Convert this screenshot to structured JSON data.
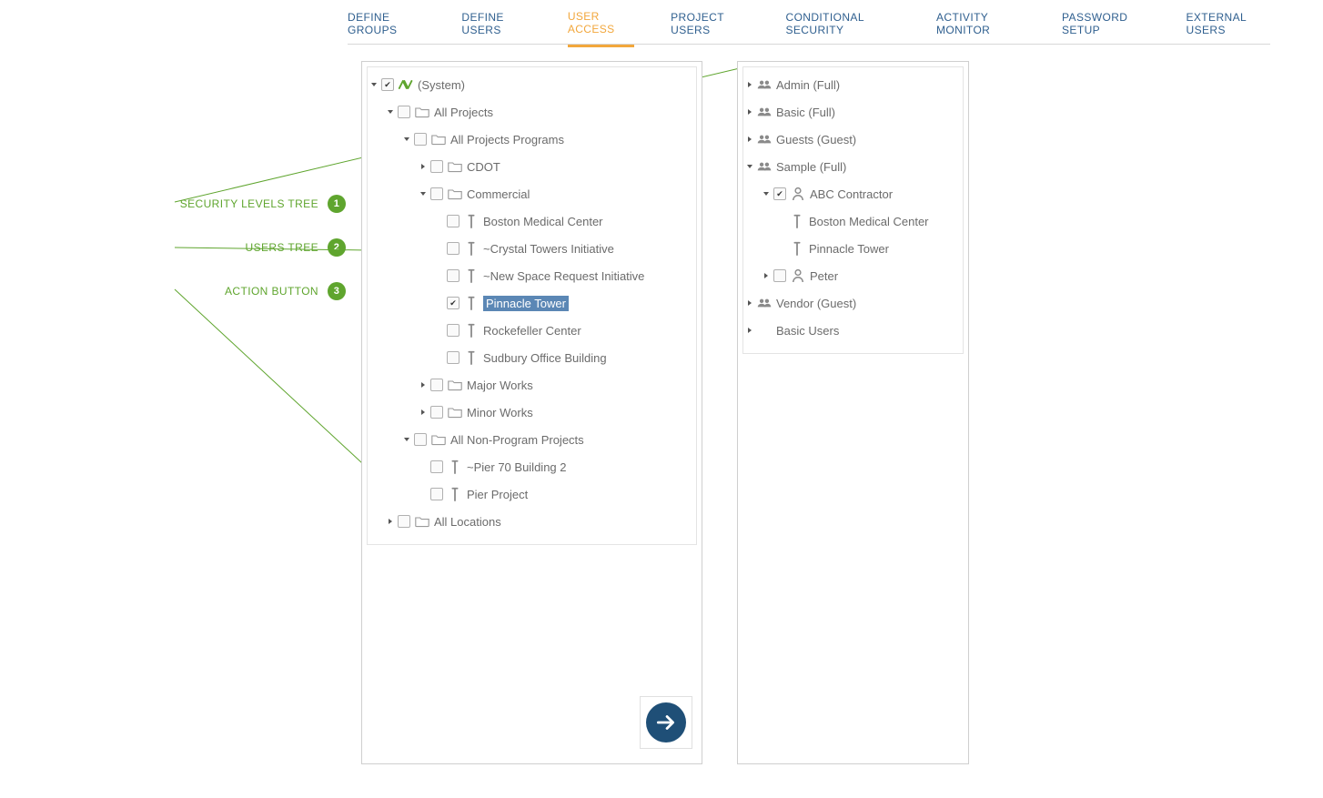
{
  "tabs": [
    {
      "label": "DEFINE GROUPS",
      "active": false
    },
    {
      "label": "DEFINE USERS",
      "active": false
    },
    {
      "label": "USER ACCESS",
      "active": true
    },
    {
      "label": "PROJECT USERS",
      "active": false
    },
    {
      "label": "CONDITIONAL SECURITY",
      "active": false
    },
    {
      "label": "ACTIVITY MONITOR",
      "active": false
    },
    {
      "label": "PASSWORD SETUP",
      "active": false
    },
    {
      "label": "EXTERNAL USERS",
      "active": false
    }
  ],
  "callouts": [
    {
      "label": "SECURITY LEVELS TREE",
      "num": "1"
    },
    {
      "label": "USERS TREE",
      "num": "2"
    },
    {
      "label": "ACTION BUTTON",
      "num": "3"
    }
  ],
  "projects_tree": [
    {
      "depth": 0,
      "disc": "open",
      "checked": true,
      "icon": "system",
      "label": "(System)"
    },
    {
      "depth": 1,
      "disc": "open",
      "checked": false,
      "icon": "folder",
      "label": "All Projects"
    },
    {
      "depth": 2,
      "disc": "open",
      "checked": false,
      "icon": "folder",
      "label": "All Projects Programs"
    },
    {
      "depth": 3,
      "disc": "closed",
      "checked": false,
      "icon": "folder",
      "label": "CDOT"
    },
    {
      "depth": 3,
      "disc": "open",
      "checked": false,
      "icon": "folder",
      "label": "Commercial"
    },
    {
      "depth": 4,
      "disc": "none",
      "checked": false,
      "icon": "proj",
      "label": "Boston Medical Center"
    },
    {
      "depth": 4,
      "disc": "none",
      "checked": false,
      "icon": "proj",
      "label": "~Crystal Towers Initiative"
    },
    {
      "depth": 4,
      "disc": "none",
      "checked": false,
      "icon": "proj",
      "label": "~New Space Request Initiative"
    },
    {
      "depth": 4,
      "disc": "none",
      "checked": true,
      "icon": "proj",
      "label": "Pinnacle Tower",
      "selected": true
    },
    {
      "depth": 4,
      "disc": "none",
      "checked": false,
      "icon": "proj",
      "label": "Rockefeller Center"
    },
    {
      "depth": 4,
      "disc": "none",
      "checked": false,
      "icon": "proj",
      "label": "Sudbury Office Building"
    },
    {
      "depth": 3,
      "disc": "closed",
      "checked": false,
      "icon": "folder",
      "label": "Major Works"
    },
    {
      "depth": 3,
      "disc": "closed",
      "checked": false,
      "icon": "folder",
      "label": "Minor Works"
    },
    {
      "depth": 2,
      "disc": "open",
      "checked": false,
      "icon": "folder",
      "label": "All Non-Program Projects"
    },
    {
      "depth": 3,
      "disc": "none",
      "checked": false,
      "icon": "proj",
      "label": "~Pier 70 Building 2"
    },
    {
      "depth": 3,
      "disc": "none",
      "checked": false,
      "icon": "proj",
      "label": "Pier Project"
    },
    {
      "depth": 1,
      "disc": "closed",
      "checked": false,
      "icon": "folder",
      "label": "All Locations"
    }
  ],
  "users_tree": [
    {
      "depth": 0,
      "disc": "closed",
      "checked": null,
      "icon": "group",
      "label": "Admin (Full)"
    },
    {
      "depth": 0,
      "disc": "closed",
      "checked": null,
      "icon": "group",
      "label": "Basic (Full)"
    },
    {
      "depth": 0,
      "disc": "closed",
      "checked": null,
      "icon": "group",
      "label": "Guests (Guest)"
    },
    {
      "depth": 0,
      "disc": "open",
      "checked": null,
      "icon": "group",
      "label": "Sample (Full)"
    },
    {
      "depth": 1,
      "disc": "open",
      "checked": true,
      "icon": "user",
      "label": "ABC Contractor"
    },
    {
      "depth": 2,
      "disc": "none",
      "checked": null,
      "icon": "proj",
      "label": "Boston Medical Center"
    },
    {
      "depth": 2,
      "disc": "none",
      "checked": null,
      "icon": "proj",
      "label": "Pinnacle Tower"
    },
    {
      "depth": 1,
      "disc": "closed",
      "checked": false,
      "icon": "user",
      "label": "Peter"
    },
    {
      "depth": 0,
      "disc": "closed",
      "checked": null,
      "icon": "group",
      "label": "Vendor (Guest)"
    },
    {
      "depth": 0,
      "disc": "closed",
      "checked": null,
      "icon": "none",
      "label": "Basic Users"
    }
  ]
}
